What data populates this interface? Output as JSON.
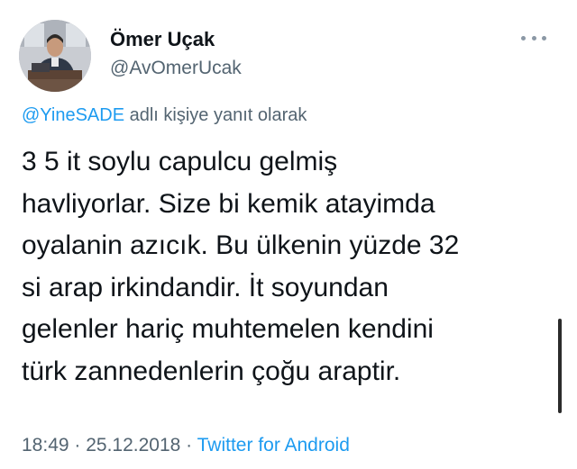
{
  "author": {
    "display_name": "Ömer Uçak",
    "handle": "@AvOmerUcak"
  },
  "more_menu_icon": "more-horizontal-icon",
  "reply_context": {
    "mention": "@YineSADE",
    "suffix": " adlı kişiye yanıt olarak"
  },
  "tweet": {
    "lines": [
      "3 5 it soylu capulcu gelmiş",
      "havliyorlar. Size bi kemik atayimda",
      "oyalanin azıcık. Bu ülkenin yüzde 32",
      "si arap irkindandir. İt soyundan",
      "gelenler hariç muhtemelen kendini",
      "türk zannedenlerin çoğu araptir."
    ]
  },
  "meta": {
    "time": "18:49",
    "separator": " · ",
    "date": "25.12.2018",
    "source": "Twitter for Android"
  },
  "colors": {
    "text": "#0f1419",
    "secondary": "#536471",
    "accent": "#1d9bf0"
  }
}
